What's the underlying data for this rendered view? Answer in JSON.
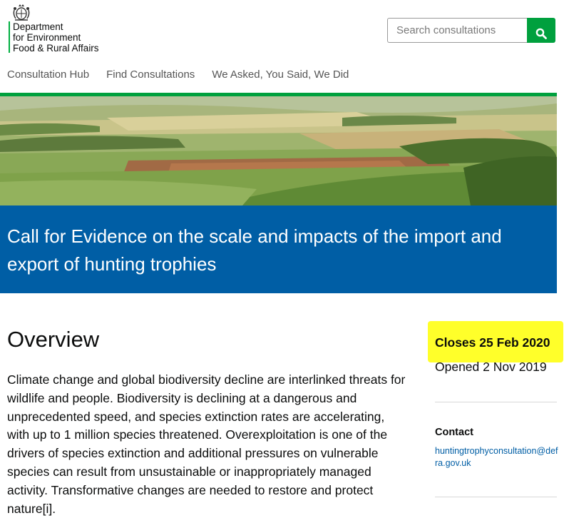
{
  "header": {
    "org_name_lines": [
      "Department",
      "for Environment",
      "Food & Rural Affairs"
    ],
    "logo_icon": "royal-crest-icon",
    "search": {
      "placeholder": "Search consultations",
      "button_icon": "search-icon"
    }
  },
  "nav": {
    "items": [
      {
        "label": "Consultation Hub"
      },
      {
        "label": "Find Consultations"
      },
      {
        "label": "We Asked, You Said, We Did"
      }
    ]
  },
  "page": {
    "title": "Call for Evidence on the scale and impacts of the import and export of hunting trophies",
    "overview_heading": "Overview",
    "overview_text": "Climate change and global biodiversity decline are interlinked threats for wildlife and people. Biodiversity is declining at a dangerous and unprecedented speed, and species extinction rates are accelerating, with up to 1 million species threatened. Overexploitation is one of the drivers of species extinction and additional pressures on vulnerable species can result from unsustainable or inappropriately managed activity. Transformative changes are needed to restore and protect nature[i]."
  },
  "sidebar": {
    "closes": "Closes 25 Feb 2020",
    "opened": "Opened 2 Nov 2019",
    "contact_label": "Contact",
    "contact_email": "huntingtrophyconsultation@defra.gov.uk"
  },
  "colors": {
    "brand_green": "#00a03e",
    "title_blue": "#005ea5",
    "highlight_yellow": "#ffff2a",
    "link_blue": "#005ea5"
  }
}
